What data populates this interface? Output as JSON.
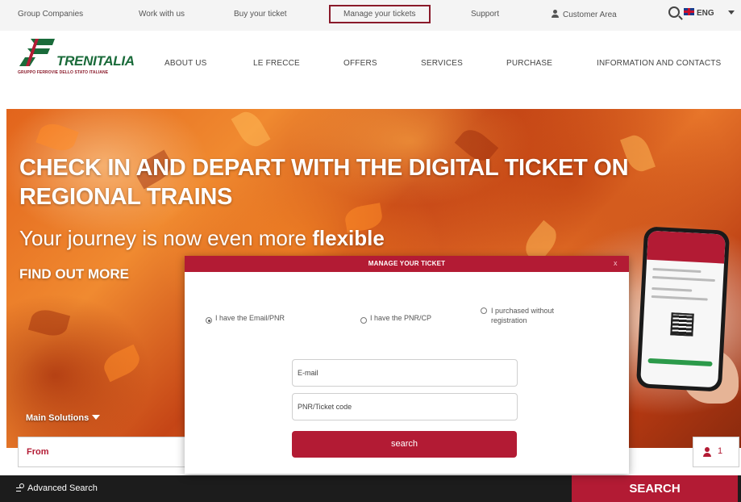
{
  "topbar": {
    "links": [
      "Group Companies",
      "Work with us",
      "Buy your ticket",
      "Manage your tickets",
      "Support"
    ],
    "customer_area": "Customer Area",
    "language": "ENG"
  },
  "brand": {
    "name": "TRENITALIA",
    "tagline": "GRUPPO FERROVIE DELLO STATO ITALIANE"
  },
  "nav": [
    "ABOUT US",
    "LE FRECCE",
    "OFFERS",
    "SERVICES",
    "PURCHASE",
    "INFORMATION AND CONTACTS"
  ],
  "hero": {
    "title": "CHECK IN AND DEPART WITH THE DIGITAL TICKET ON REGIONAL TRAINS",
    "subtitle_prefix": "Your journey is now even more ",
    "subtitle_bold": "flexible",
    "cta": "FIND OUT MORE"
  },
  "search_panel": {
    "main_solutions": "Main Solutions",
    "from_label": "From",
    "passengers": "1",
    "advanced_search": "Advanced Search",
    "search_button": "SEARCH"
  },
  "modal": {
    "title": "MANAGE YOUR TICKET",
    "close": "x",
    "options": [
      {
        "label": "I have the Email/PNR",
        "checked": true
      },
      {
        "label": "I have the PNR/CP",
        "checked": false
      },
      {
        "label": "I purchased without registration",
        "checked": false
      }
    ],
    "email_placeholder": "E-mail",
    "pnr_placeholder": "PNR/Ticket code",
    "search_button": "search"
  },
  "colors": {
    "brand_red": "#b31b34",
    "brand_green": "#1a6b3a",
    "highlight_border": "#8a1a2a"
  }
}
